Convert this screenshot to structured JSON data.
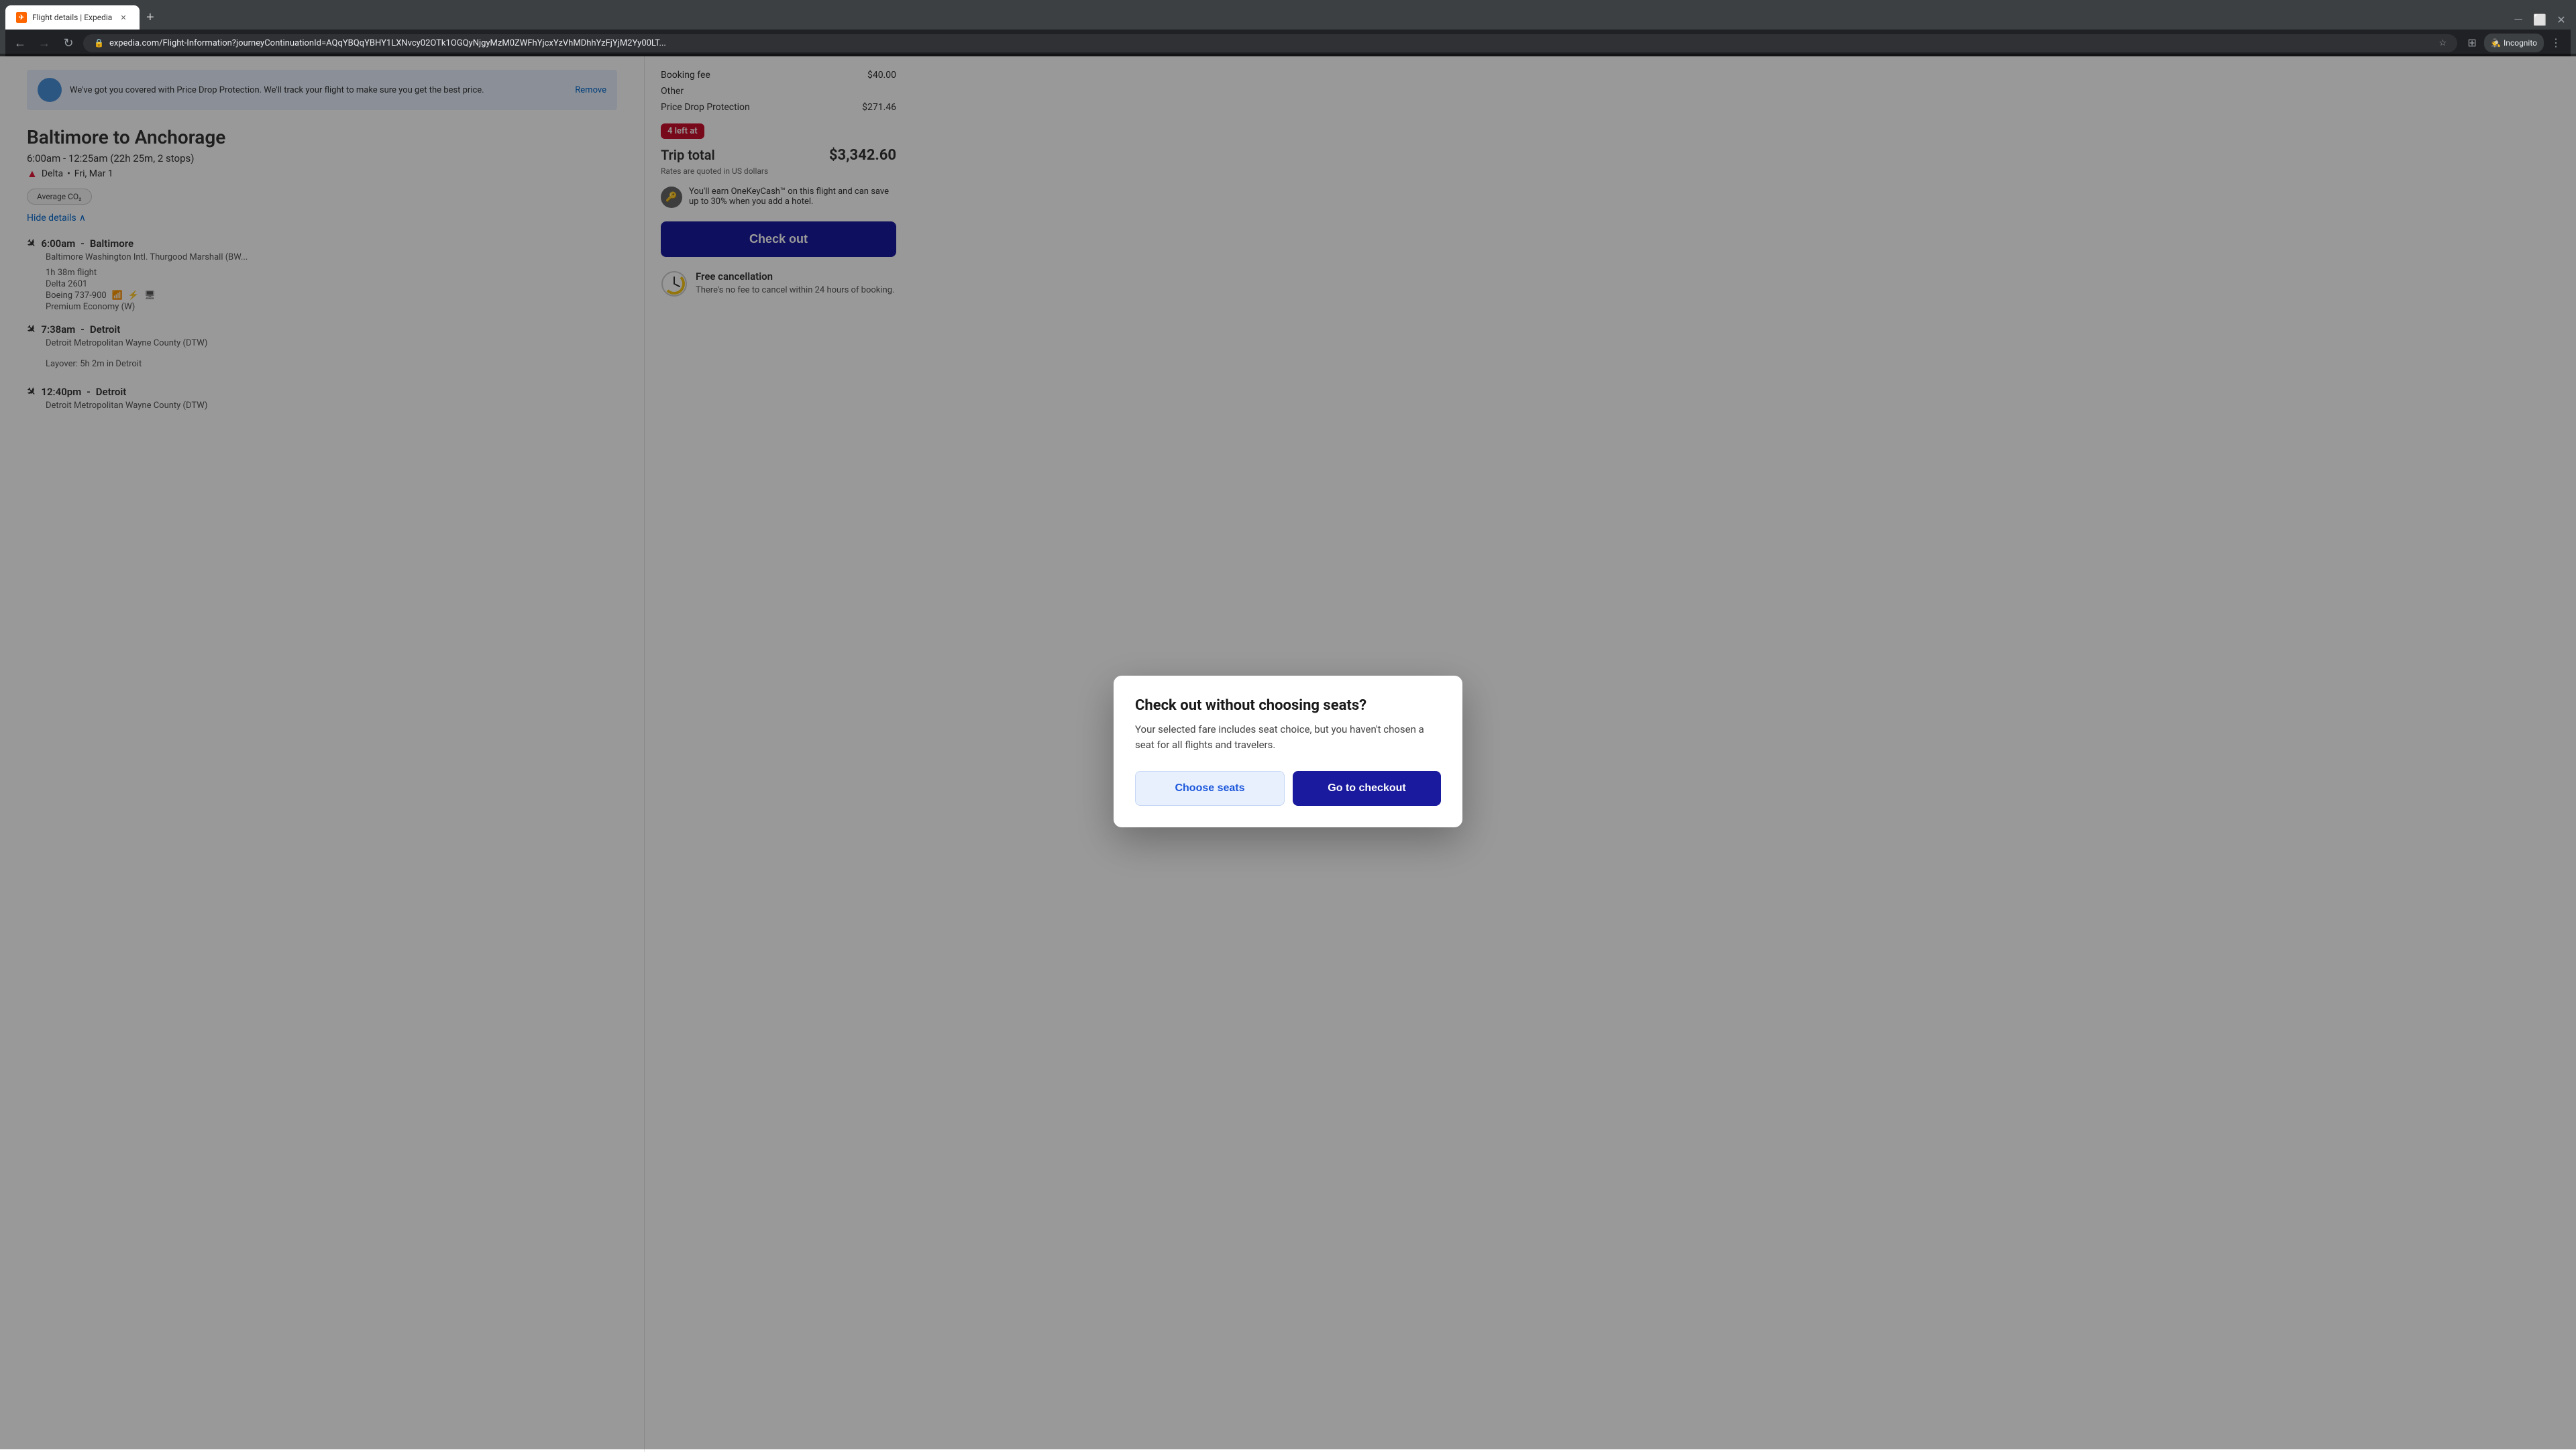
{
  "browser": {
    "tab_title": "Flight details | Expedia",
    "url": "expedia.com/Flight-Information?journeyContinuationId=AQqYBQqYBHY1LXNvcy02OTk1OGQyNjgyMzM0ZWFhYjcxYzVhMDhhYzFjYjM2Yy00LT...",
    "incognito_label": "Incognito",
    "new_tab_label": "+"
  },
  "sidebar": {
    "protect_text": "We've got you covered with Price Drop Protection. We'll track your flight to make sure you get the best price.",
    "remove_label": "Remove"
  },
  "right_panel": {
    "booking_fee_label": "Booking fee",
    "booking_fee_value": "$40.00",
    "other_label": "Other",
    "price_drop_label": "Price Drop Protection",
    "price_drop_value": "$271.46",
    "seats_badge": "4 left at",
    "trip_total_label": "Trip total",
    "trip_total_value": "$3,342.60",
    "rates_note": "Rates are quoted in US dollars",
    "onekey_note": "You'll earn OneKeyCash™ on this flight and can save up to 30% when you add a hotel.",
    "checkout_btn_label": "Check out",
    "free_cancel_title": "Free cancellation",
    "free_cancel_desc": "There's no fee to cancel within 24 hours of booking."
  },
  "flight": {
    "route": "Baltimore to Anchorage",
    "time_range": "6:00am - 12:25am (22h 25m, 2 stops)",
    "carrier": "Delta",
    "date": "Fri, Mar 1",
    "co2_badge": "Average CO₂",
    "hide_details": "Hide details",
    "legs": [
      {
        "time": "6:00am",
        "city": "Baltimore",
        "airport": "Baltimore Washington Intl. Thurgood Marshall (BW...",
        "duration": "1h 38m flight",
        "flight_num": "Delta 2601",
        "aircraft": "Boeing 737-900",
        "class": "Premium Economy (W)"
      },
      {
        "time": "7:38am",
        "city": "Detroit",
        "airport": "Detroit Metropolitan Wayne County (DTW)",
        "layover": "Layover: 5h 2m in Detroit"
      },
      {
        "time": "12:40pm",
        "city": "Detroit",
        "airport": "Detroit Metropolitan Wayne County (DTW)"
      }
    ]
  },
  "modal": {
    "title": "Check out without choosing seats?",
    "description": "Your selected fare includes seat choice, but you haven't chosen a seat for all flights and travelers.",
    "choose_seats_label": "Choose seats",
    "go_to_checkout_label": "Go to checkout"
  }
}
